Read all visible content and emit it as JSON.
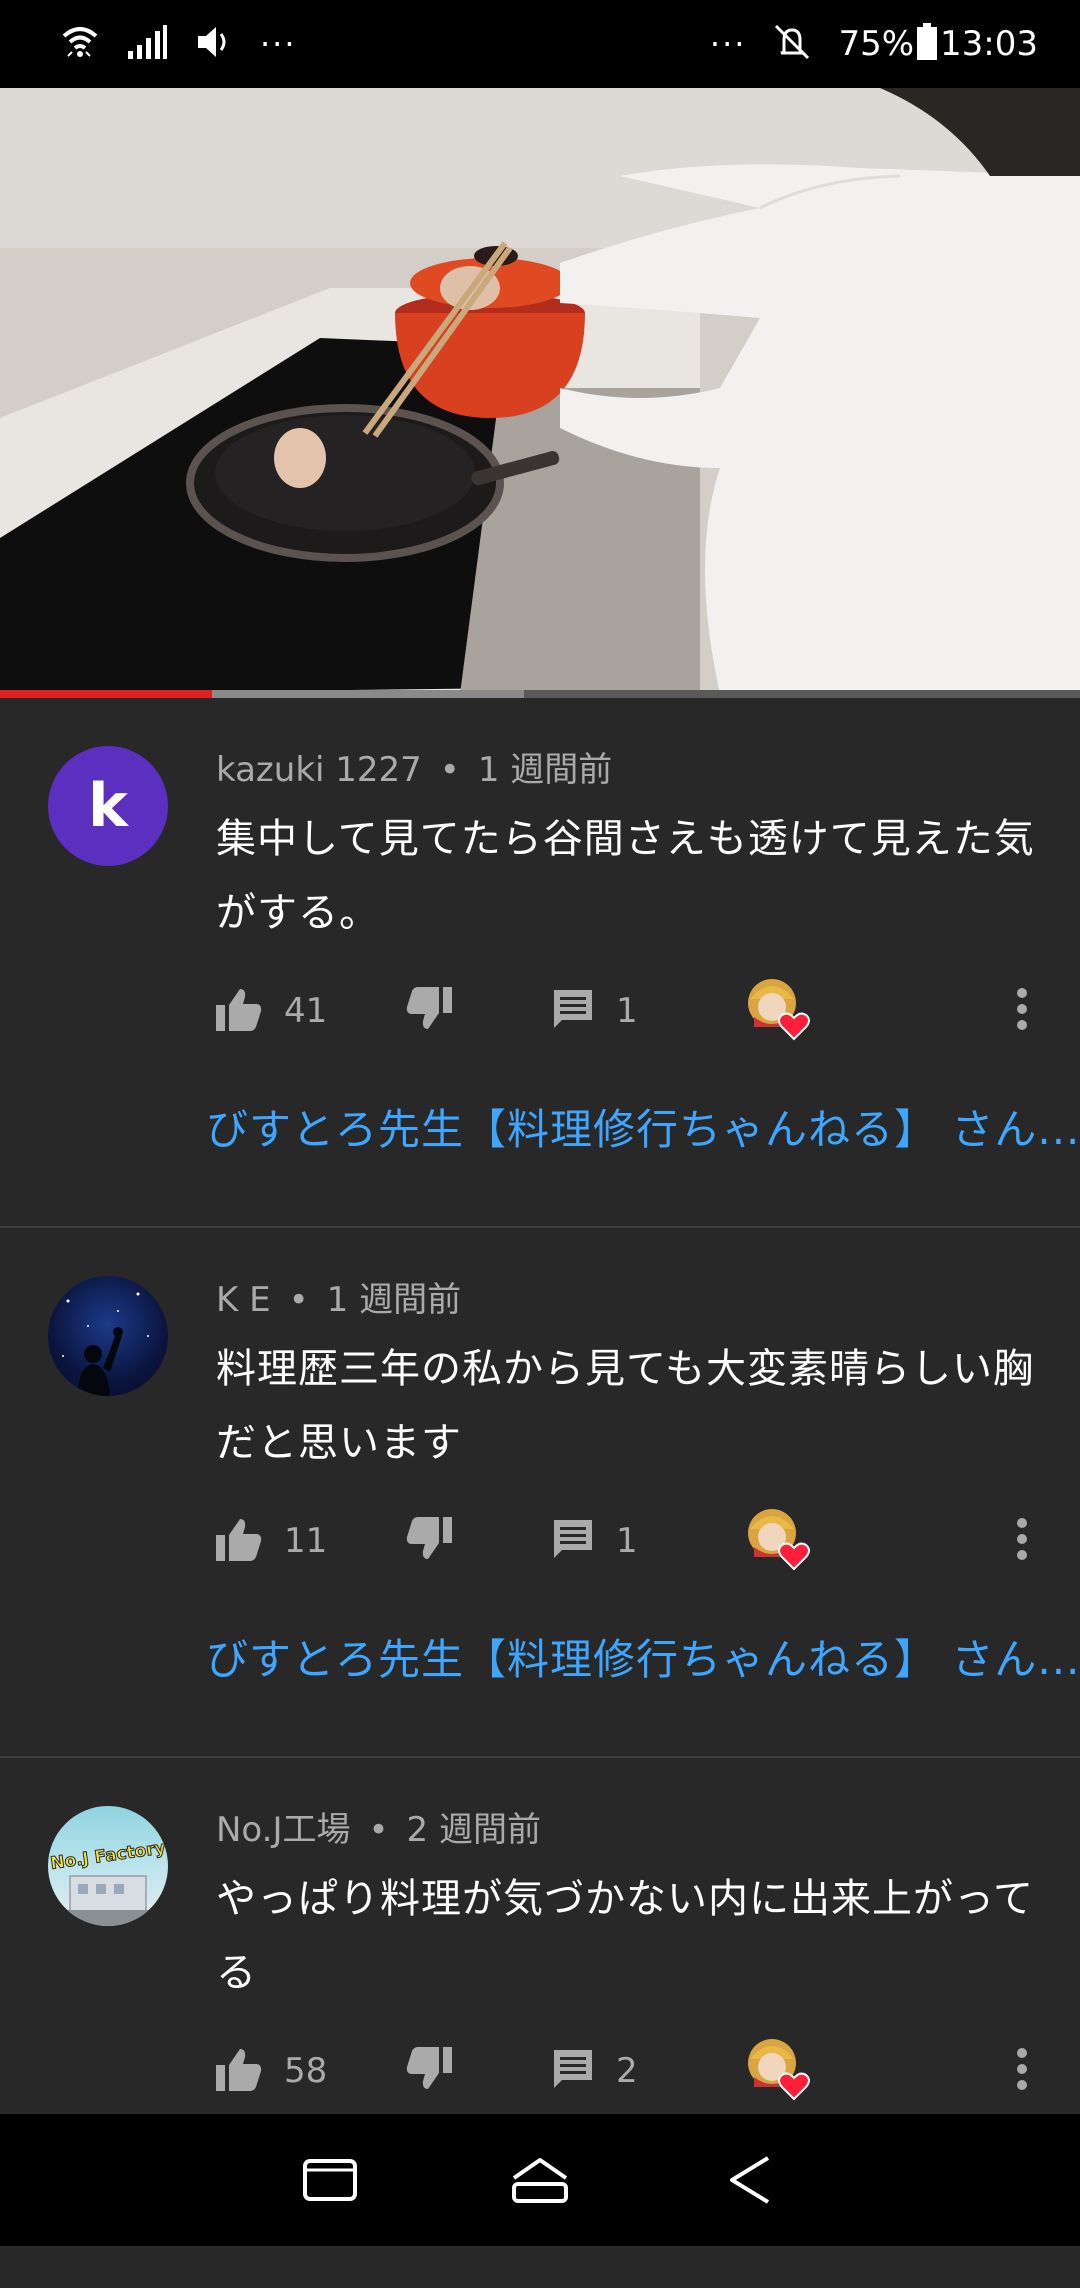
{
  "status_bar": {
    "left_dots": "···",
    "right_dots": "···",
    "battery": "75%",
    "time": "13:03"
  },
  "video": {
    "progress": 0.196,
    "buffered": 0.485
  },
  "comments": [
    {
      "author": "kazuki 1227",
      "time": "1 週間前",
      "avatar_letter": "k",
      "text": "集中して見てたら谷間さえも透けて見えた気がする。",
      "likes": "41",
      "replies": "1",
      "creator_reply": "びすとろ先生【料理修行ちゃんねる】 さん..."
    },
    {
      "author": "K E",
      "time": "1 週間前",
      "text": "料理歴三年の私から見ても大変素晴らしい胸だと思います",
      "likes": "11",
      "replies": "1",
      "creator_reply": "びすとろ先生【料理修行ちゃんねる】 さん..."
    },
    {
      "author": "No.J工場",
      "time": "2 週間前",
      "avatar_logo": "No.J Factory",
      "text": "やっぱり料理が気づかない内に出来上がってる",
      "likes": "58",
      "replies": "2"
    }
  ]
}
